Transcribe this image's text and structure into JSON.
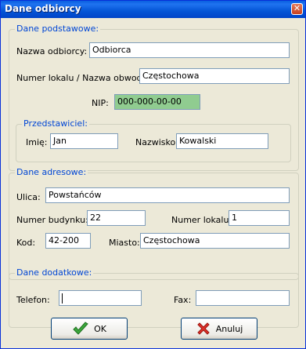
{
  "window": {
    "title": "Dane odbiorcy"
  },
  "basic": {
    "legend": "Dane podstawowe:",
    "name_label": "Nazwa odbiorcy:",
    "name_value": "Odbiorca",
    "premises_label": "Numer lokalu / Nazwa obwodu:",
    "premises_value": "Częstochowa",
    "nip_label": "NIP:",
    "nip_value": "000-000-00-00",
    "rep_legend": "Przedstawiciel:",
    "first_name_label": "Imię:",
    "first_name_value": "Jan",
    "last_name_label": "Nazwisko:",
    "last_name_value": "Kowalski"
  },
  "address": {
    "legend": "Dane adresowe:",
    "street_label": "Ulica:",
    "street_value": "Powstańców",
    "building_label": "Numer budynku:",
    "building_value": "22",
    "apt_label": "Numer lokalu:",
    "apt_value": "1",
    "postcode_label": "Kod:",
    "postcode_value": "42-200",
    "city_label": "Miasto:",
    "city_value": "Częstochowa"
  },
  "extra": {
    "legend": "Dane dodatkowe:",
    "phone_label": "Telefon:",
    "phone_value": "",
    "fax_label": "Fax:",
    "fax_value": ""
  },
  "buttons": {
    "ok": "OK",
    "cancel": "Anuluj"
  },
  "colors": {
    "legend": "#0046D5",
    "nip_field": "#90CC90",
    "titlebar": "#0455D6"
  }
}
